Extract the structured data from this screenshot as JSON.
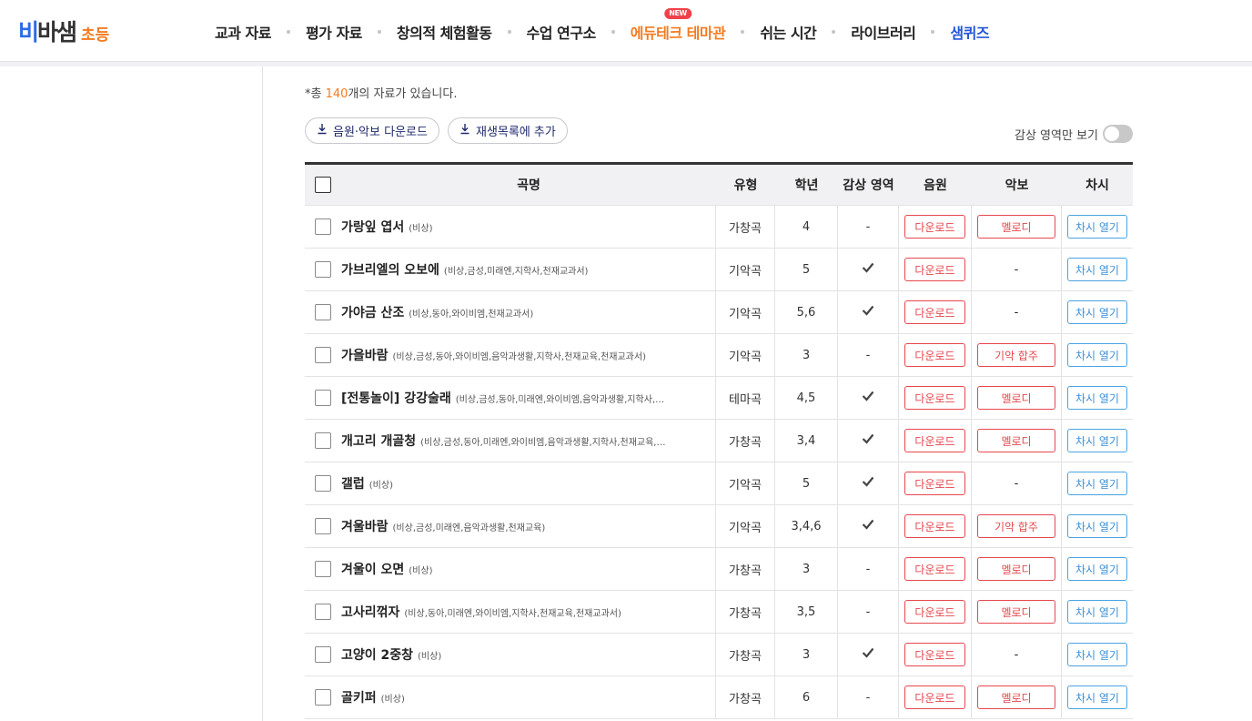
{
  "header": {
    "logo_main_a": "비",
    "logo_main_b": "바샘",
    "logo_sub": "초등",
    "nav": [
      {
        "label": "교과 자료",
        "style": "normal"
      },
      {
        "label": "평가 자료",
        "style": "normal"
      },
      {
        "label": "창의적 체험활동",
        "style": "normal"
      },
      {
        "label": "수업 연구소",
        "style": "normal"
      },
      {
        "label": "에듀테크 테마관",
        "style": "orange",
        "badge": "NEW"
      },
      {
        "label": "쉬는 시간",
        "style": "normal"
      },
      {
        "label": "라이브러리",
        "style": "normal"
      },
      {
        "label": "샘퀴즈",
        "style": "blue"
      }
    ]
  },
  "summary": {
    "prefix": "*총 ",
    "count": "140",
    "suffix": "개의 자료가 있습니다."
  },
  "toolbar": {
    "download_label": "음원·악보 다운로드",
    "playlist_label": "재생목록에 추가",
    "toggle_label": "감상 영역만 보기"
  },
  "table": {
    "headers": {
      "name": "곡명",
      "type": "유형",
      "grade": "학년",
      "area": "감상 영역",
      "audio": "음원",
      "score": "악보",
      "lesson": "차시"
    },
    "rows": [
      {
        "title": "가랑잎 엽서",
        "pubs": "(비상)",
        "type": "가창곡",
        "grade": "4",
        "area": "-",
        "audio": "다운로드",
        "score": "멜로디",
        "lesson": "차시 열기"
      },
      {
        "title": "가브리엘의 오보에",
        "pubs": "(비상,금성,미래엔,지학사,천재교과서)",
        "type": "기악곡",
        "grade": "5",
        "area": "check",
        "audio": "다운로드",
        "score": "-",
        "lesson": "차시 열기"
      },
      {
        "title": "가야금 산조",
        "pubs": "(비상,동아,와이비엠,천재교과서)",
        "type": "기악곡",
        "grade": "5,6",
        "area": "check",
        "audio": "다운로드",
        "score": "-",
        "lesson": "차시 열기"
      },
      {
        "title": "가을바람",
        "pubs": "(비상,금성,동아,와이비엠,음악과생활,지학사,천재교육,천재교과서)",
        "type": "기악곡",
        "grade": "3",
        "area": "-",
        "audio": "다운로드",
        "score": "기악 합주",
        "lesson": "차시 열기"
      },
      {
        "title": "[전통놀이] 강강술래",
        "pubs": "(비상,금성,동아,미래엔,와이비엠,음악과생활,지학사,…",
        "type": "테마곡",
        "grade": "4,5",
        "area": "check",
        "audio": "다운로드",
        "score": "멜로디",
        "lesson": "차시 열기"
      },
      {
        "title": "개고리 개골청",
        "pubs": "(비상,금성,동아,미래엔,와이비엠,음악과생활,지학사,천재교육,…",
        "type": "가창곡",
        "grade": "3,4",
        "area": "check",
        "audio": "다운로드",
        "score": "멜로디",
        "lesson": "차시 열기"
      },
      {
        "title": "갤럽",
        "pubs": "(비상)",
        "type": "기악곡",
        "grade": "5",
        "area": "check",
        "audio": "다운로드",
        "score": "-",
        "lesson": "차시 열기"
      },
      {
        "title": "겨울바람",
        "pubs": "(비상,금성,미래엔,음악과생활,천재교육)",
        "type": "기악곡",
        "grade": "3,4,6",
        "area": "check",
        "audio": "다운로드",
        "score": "기악 합주",
        "lesson": "차시 열기"
      },
      {
        "title": "겨울이 오면",
        "pubs": "(비상)",
        "type": "가창곡",
        "grade": "3",
        "area": "-",
        "audio": "다운로드",
        "score": "멜로디",
        "lesson": "차시 열기"
      },
      {
        "title": "고사리꺾자",
        "pubs": "(비상,동아,미래엔,와이비엠,지학사,천재교육,천재교과서)",
        "type": "가창곡",
        "grade": "3,5",
        "area": "-",
        "audio": "다운로드",
        "score": "멜로디",
        "lesson": "차시 열기"
      },
      {
        "title": "고양이 2중창",
        "pubs": "(비상)",
        "type": "가창곡",
        "grade": "3",
        "area": "check",
        "audio": "다운로드",
        "score": "-",
        "lesson": "차시 열기"
      },
      {
        "title": "골키퍼",
        "pubs": "(비상)",
        "type": "가창곡",
        "grade": "6",
        "area": "-",
        "audio": "다운로드",
        "score": "멜로디",
        "lesson": "차시 열기"
      }
    ]
  },
  "colors": {
    "accent_orange": "#F47B20",
    "accent_blue": "#2557D6",
    "button_red": "#E6474E",
    "button_blue": "#3A8FD8"
  }
}
